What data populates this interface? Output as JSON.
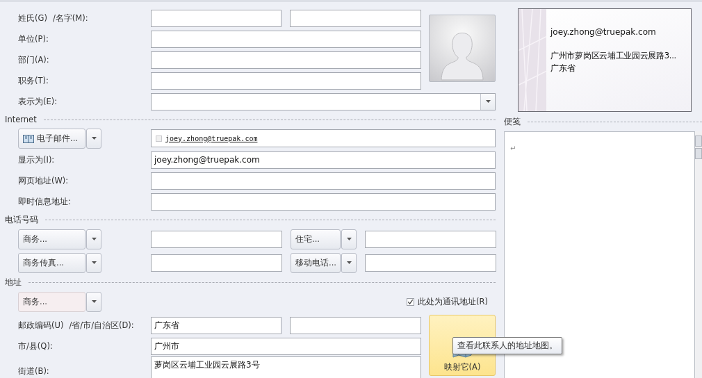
{
  "identity": {
    "last_name_label": "姓氏(G)",
    "first_name_label": "/名字(M):",
    "rows": [
      {
        "label": "单位(P):"
      },
      {
        "label": "部门(A):"
      },
      {
        "label": "职务(T):"
      }
    ],
    "file_as_label": "表示为(E):"
  },
  "internet": {
    "heading": "Internet",
    "email_button": "电子邮件...",
    "email_checked": false,
    "email_value": "joey.zhong@truepak.com",
    "display_label": "显示为(I):",
    "display_value": "joey.zhong@truepak.com",
    "web_label": "网页地址(W):",
    "im_label": "即时信息地址:"
  },
  "phones": {
    "heading": "电话号码",
    "buttons": [
      "商务...",
      "住宅...",
      "商务传真...",
      "移动电话..."
    ]
  },
  "address": {
    "heading": "地址",
    "type_button": "商务...",
    "mailing_label": "此处为通讯地址(R)",
    "mailing_checked": true,
    "postal_label": "邮政编码(U)",
    "province_label": "/省/市/自治区(D):",
    "province_value": "广东省",
    "city_label": "市/县(Q):",
    "city_value": "广州市",
    "street_label": "街道(B):",
    "street_value": "萝岗区云埔工业园云展路3号",
    "map_button": "映射它(A)",
    "tooltip": "查看此联系人的地址地图。"
  },
  "business_card": {
    "lines": [
      "joey.zhong@truepak.com",
      "广州市萝岗区云埔工业园云展路3...",
      "广东省"
    ]
  },
  "notes": {
    "heading": "便笺",
    "mark": "↵"
  }
}
